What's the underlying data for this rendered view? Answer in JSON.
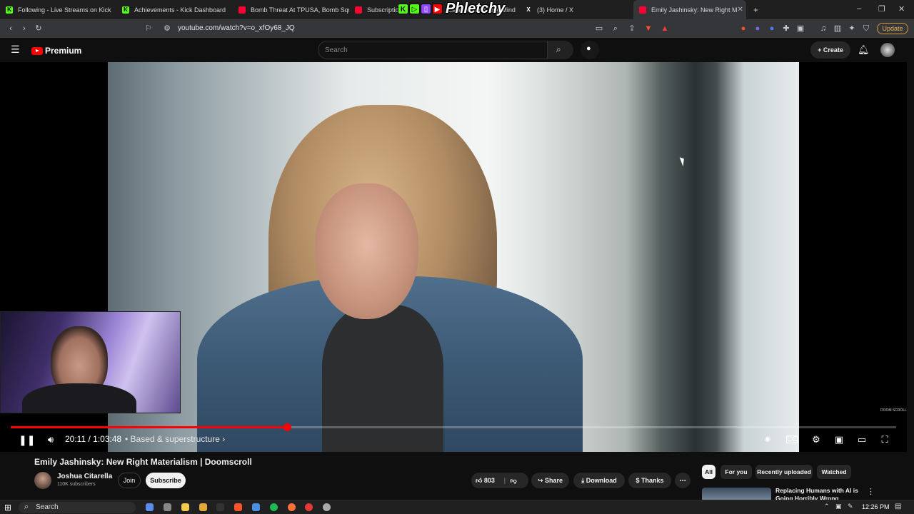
{
  "browser": {
    "tabs": [
      {
        "label": "Following - Live Streams on Kick",
        "color": "#53fc18"
      },
      {
        "label": "Achievements - Kick Dashboard",
        "color": "#53fc18"
      },
      {
        "label": "Bomb Threat At TPUSA, Bomb Squad",
        "color": "#ff0033"
      },
      {
        "label": "Subscriptio",
        "color": "#ff0033"
      },
      {
        "label": "olent | Change My Mind",
        "color": "#ff0033"
      },
      {
        "label": "(3) Home / X",
        "color": "#ffffff"
      },
      {
        "label": "Emily Jashinsky: New Right M",
        "color": "#ff0033"
      }
    ],
    "url": "youtube.com/watch?v=o_xfOy68_JQ",
    "update_label": "Update"
  },
  "overlay": {
    "streamer_name": "Phletchy"
  },
  "youtube": {
    "logo_text": "Premium",
    "search_placeholder": "Search",
    "create_label": "Create"
  },
  "player": {
    "current_time": "20:11",
    "duration": "1:03:48",
    "time_display": "20:11 / 1:03:48",
    "chapter": "• Based & superstructure ›",
    "progress_fraction": 0.312,
    "watermark": "DOOM SCROLL"
  },
  "video": {
    "title": "Emily Jashinsky: New Right Materialism | Doomscroll",
    "channel": "Joshua Citarella",
    "subscribers": "110K subscribers",
    "join_label": "Join",
    "subscribe_label": "Subscribe",
    "likes": "803",
    "share_label": "Share",
    "download_label": "Download",
    "thanks_label": "Thanks"
  },
  "sidebar": {
    "chips": [
      "All",
      "For you",
      "Recently uploaded",
      "Watched"
    ],
    "recommendation_title": "Replacing Humans with AI is Going Horribly Wrong"
  },
  "taskbar": {
    "search_label": "Search",
    "clock": "12:26 PM"
  }
}
